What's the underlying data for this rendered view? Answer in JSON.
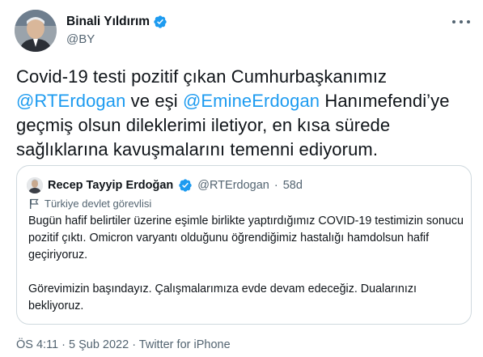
{
  "author": {
    "name": "Binali Yıldırım",
    "handle": "@BY"
  },
  "tweet": {
    "line1": "Covid-19 testi pozitif çıkan Cumhurbaşkanımız",
    "mention1": "@RTErdogan",
    "mid1": " ve eşi ",
    "mention2": "@EmineErdogan",
    "end1": " Hanımefendi’ye",
    "line3": "geçmiş olsun dileklerimi iletiyor, en kısa sürede",
    "line4": "sağlıklarına kavuşmalarını temenni ediyorum."
  },
  "quote": {
    "name": "Recep Tayyip Erdoğan",
    "handle": "@RTErdogan",
    "dot": "·",
    "time": "58d",
    "label": "Türkiye devlet görevlisi",
    "paragraph1": "Bugün hafif belirtiler üzerine eşimle birlikte yaptırdığımız COVID-19 testimizin sonucu pozitif çıktı. Omicron varyantı olduğunu öğrendiğimiz hastalığı hamdolsun hafif geçiriyoruz.",
    "paragraph2": "Görevimizin başındayız. Çalışmalarımıza evde devam edeceğiz. Dualarınızı bekliyoruz."
  },
  "meta": {
    "text": "ÖS 4:11 · 5 Şub 2022 · Twitter for iPhone"
  },
  "colors": {
    "accent": "#1d9bf0",
    "muted": "#536471",
    "text": "#0f1419",
    "border": "#cfd9de"
  },
  "icons": {
    "verified": "verified-badge-icon",
    "more": "more-options-icon",
    "label": "flag-icon"
  }
}
